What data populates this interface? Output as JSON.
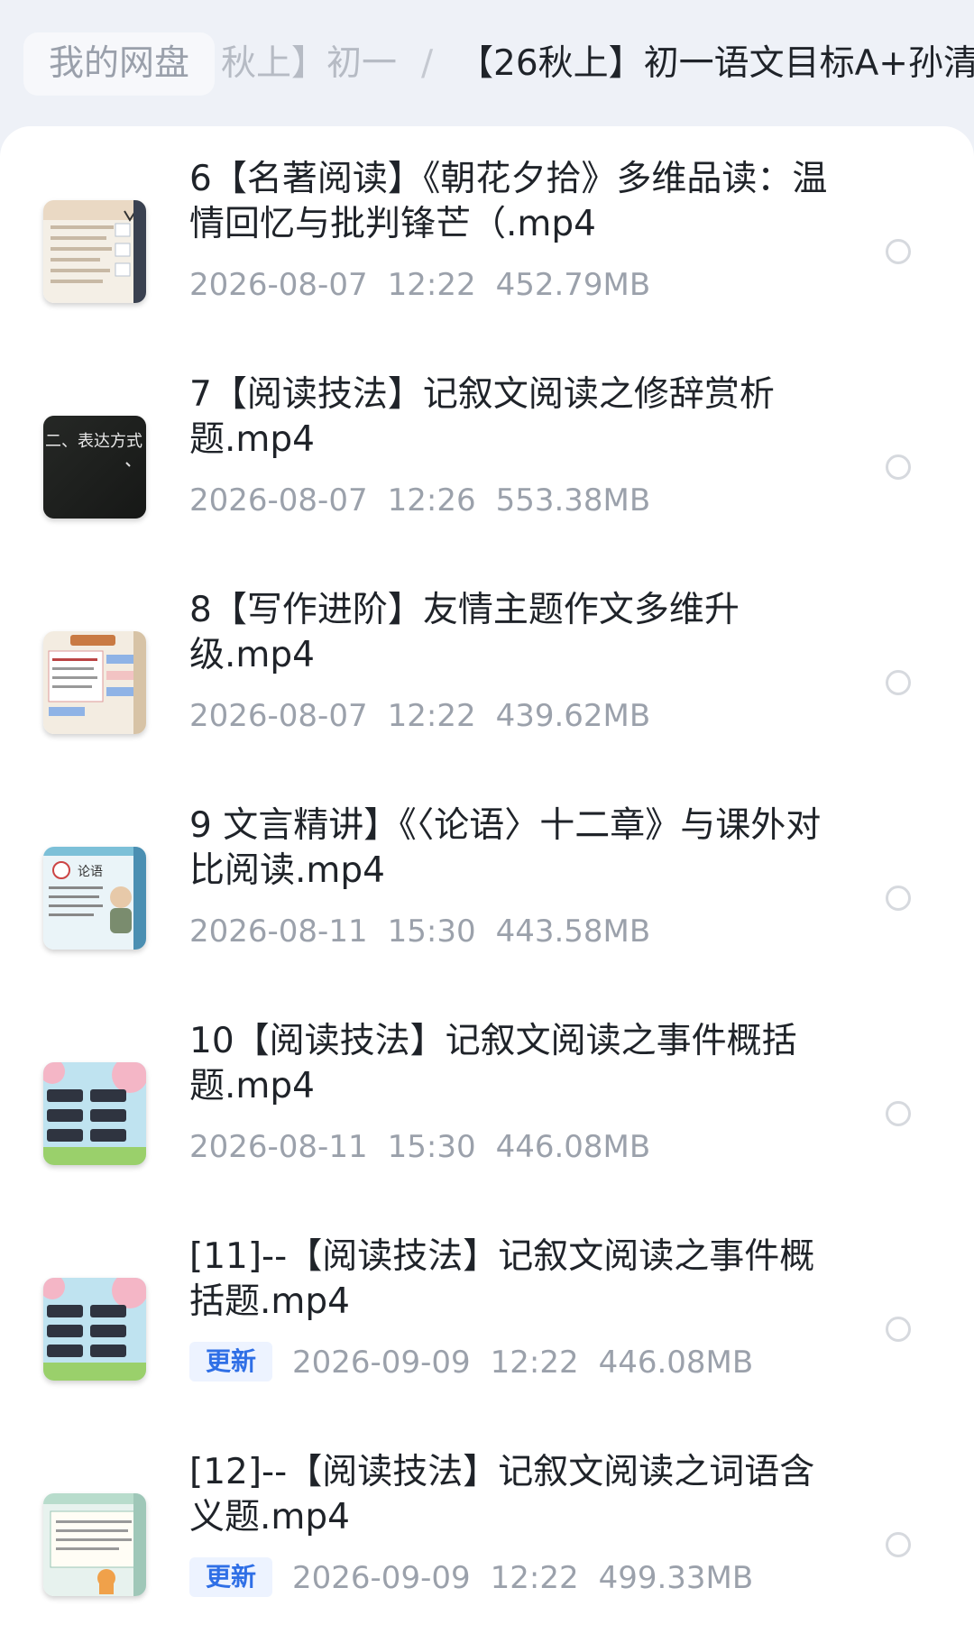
{
  "breadcrumb": {
    "home": "我的网盘",
    "middle": "秋上】初一",
    "separator": "/",
    "current": "【26秋上】初一语文目标A+孙清"
  },
  "files": [
    {
      "title": "6【名著阅读】《朝花夕拾》多维品读：温情回忆与批判锋芒（.mp4",
      "date": "2026-08-07",
      "time": "12:22",
      "size": "452.79MB",
      "badge": ""
    },
    {
      "title": "7【阅读技法】记叙文阅读之修辞赏析题.mp4",
      "date": "2026-08-07",
      "time": "12:26",
      "size": "553.38MB",
      "badge": ""
    },
    {
      "title": "8【写作进阶】友情主题作文多维升级.mp4",
      "date": "2026-08-07",
      "time": "12:22",
      "size": "439.62MB",
      "badge": ""
    },
    {
      "title": "9 文言精讲】《〈论语〉十二章》与课外对比阅读.mp4",
      "date": "2026-08-11",
      "time": "15:30",
      "size": "443.58MB",
      "badge": ""
    },
    {
      "title": "10【阅读技法】记叙文阅读之事件概括题.mp4",
      "date": "2026-08-11",
      "time": "15:30",
      "size": "446.08MB",
      "badge": ""
    },
    {
      "title": "[11]--【阅读技法】记叙文阅读之事件概括题.mp4",
      "date": "2026-09-09",
      "time": "12:22",
      "size": "446.08MB",
      "badge": "更新"
    },
    {
      "title": "[12]--【阅读技法】记叙文阅读之词语含义题.mp4",
      "date": "2026-09-09",
      "time": "12:22",
      "size": "499.33MB",
      "badge": "更新"
    }
  ],
  "thumb_text": {
    "blackboard": "二、表达方式",
    "lunyu_sign": "论语"
  },
  "colors": {
    "accent": "#2f6fe6",
    "badge_bg": "#edf3ff",
    "meta_text": "#9ba1ab",
    "title_text": "#1f2329"
  }
}
